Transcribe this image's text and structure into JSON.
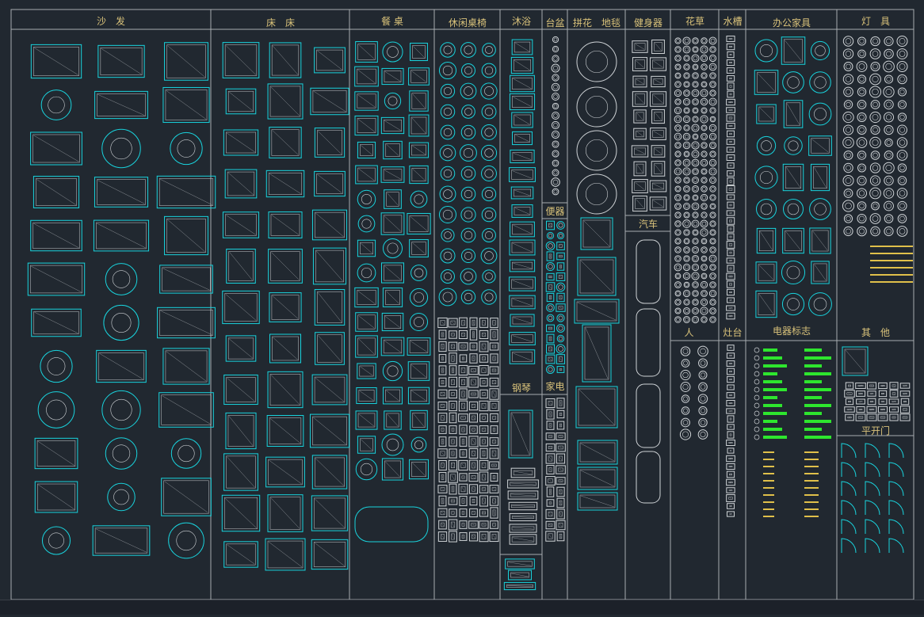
{
  "colors": {
    "background": "#212830",
    "grid_line": "#a8acb0",
    "header_text": "#d9c27a",
    "block_cyan": "#19d3dd",
    "block_white": "#cfd3d6",
    "block_green": "#2ee62e",
    "block_gold": "#e0c04a"
  },
  "sections": [
    {
      "key": "sofa",
      "title": "沙　发"
    },
    {
      "key": "bed",
      "title": "床　床"
    },
    {
      "key": "dining",
      "title": "餐 桌"
    },
    {
      "key": "leisure",
      "title": "休闲桌椅"
    },
    {
      "key": "bath",
      "title": "沐浴"
    },
    {
      "key": "basin",
      "title": "台盆"
    },
    {
      "key": "parquet",
      "title": "拼花　地毯"
    },
    {
      "key": "gym",
      "title": "健身器"
    },
    {
      "key": "plants",
      "title": "花草"
    },
    {
      "key": "sink",
      "title": "水槽"
    },
    {
      "key": "office",
      "title": "办公家具"
    },
    {
      "key": "lamps",
      "title": "灯　具"
    }
  ],
  "subsections": [
    {
      "key": "toilet",
      "title": "便器"
    },
    {
      "key": "car",
      "title": "汽车"
    },
    {
      "key": "people",
      "title": "人"
    },
    {
      "key": "stove",
      "title": "灶台"
    },
    {
      "key": "electric_signs",
      "title": "电器标志"
    },
    {
      "key": "others",
      "title": "其　他"
    },
    {
      "key": "piano",
      "title": "钢琴"
    },
    {
      "key": "appliance",
      "title": "家电"
    },
    {
      "key": "door",
      "title": "平开门"
    }
  ]
}
